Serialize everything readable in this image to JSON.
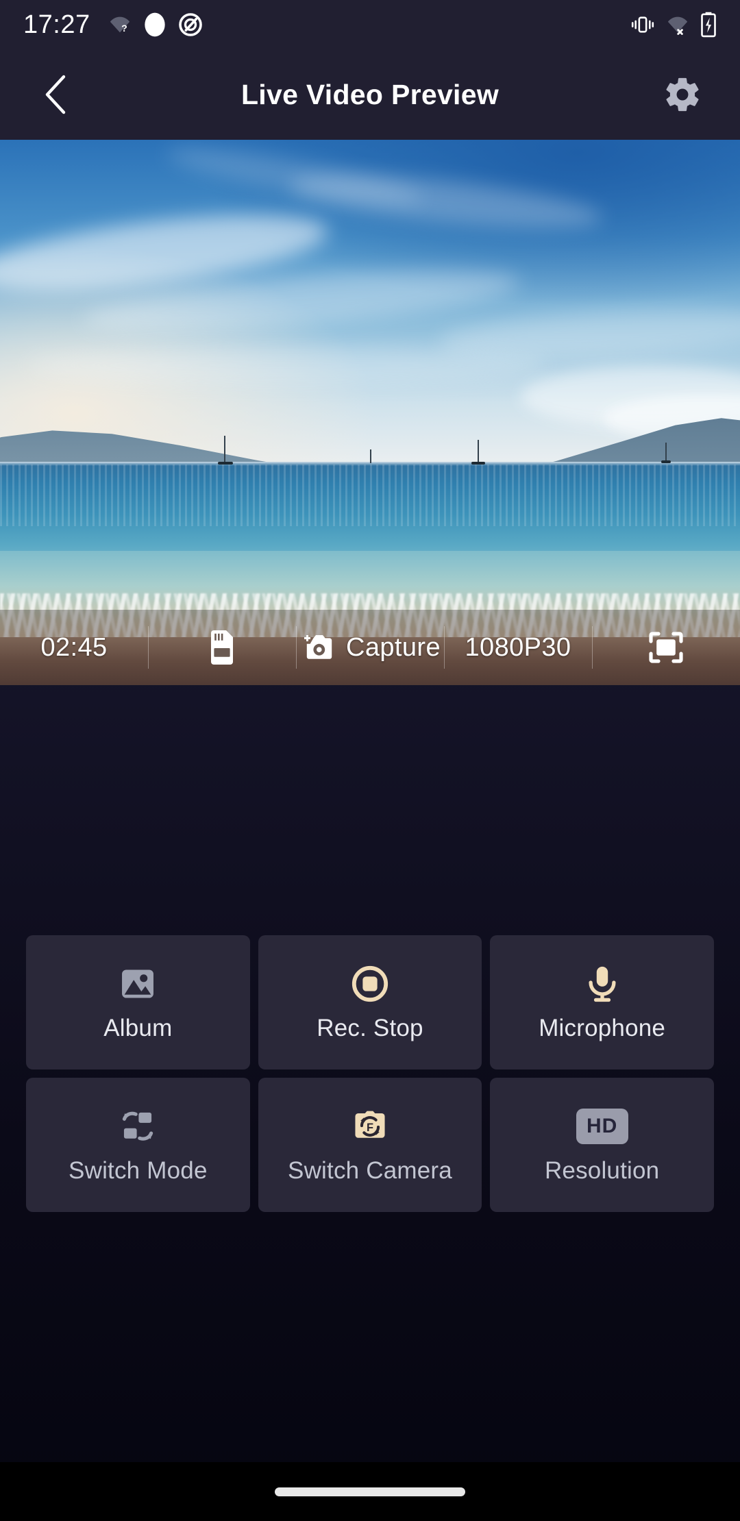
{
  "status_bar": {
    "time": "17:27",
    "left_icons": [
      "wifi-unknown-icon",
      "circle-indicator-icon",
      "do-not-disturb-icon"
    ],
    "right_icons": [
      "vibrate-icon",
      "wifi-off-icon",
      "battery-charging-icon"
    ]
  },
  "header": {
    "title": "Live Video Preview",
    "back_icon": "back-chevron-icon",
    "settings_icon": "gear-icon"
  },
  "video_overlay": {
    "recording_time": "02:45",
    "sd_card_icon": "sd-card-icon",
    "capture_icon": "add-photo-camera-icon",
    "capture_label": "Capture",
    "resolution_value": "1080P30",
    "fullscreen_icon": "fullscreen-icon"
  },
  "controls": {
    "tiles": [
      {
        "id": "album",
        "label": "Album",
        "icon": "image-gallery-icon",
        "icon_color": "#9da1b0",
        "label_color": "#e9eaf0"
      },
      {
        "id": "rec-stop",
        "label": "Rec. Stop",
        "icon": "record-stop-icon",
        "icon_color": "#f0dcb8",
        "label_color": "#ffffff"
      },
      {
        "id": "microphone",
        "label": "Microphone",
        "icon": "microphone-icon",
        "icon_color": "#f0dcb8",
        "label_color": "#ffffff"
      },
      {
        "id": "switch-mode",
        "label": "Switch Mode",
        "icon": "switch-mode-icon",
        "icon_color": "#9da1b0",
        "label_color": "#c3c6d2"
      },
      {
        "id": "switch-camera",
        "label": "Switch Camera",
        "icon": "switch-camera-icon",
        "icon_color": "#f0dcb8",
        "label_color": "#c3c6d2"
      },
      {
        "id": "resolution",
        "label": "Resolution",
        "icon": "hd-badge-icon",
        "icon_color": "#9a9cab",
        "label_color": "#c3c6d2",
        "badge_text": "HD"
      }
    ]
  },
  "navigation_bar": {
    "home_indicator": "home-indicator-pill"
  },
  "theme": {
    "header_bg": "#211f31",
    "page_bg": "#0b0a18",
    "tile_bg": "#2a2839",
    "accent_cream": "#f0dcb8",
    "text_primary": "#ffffff",
    "text_muted": "#c3c6d2"
  }
}
